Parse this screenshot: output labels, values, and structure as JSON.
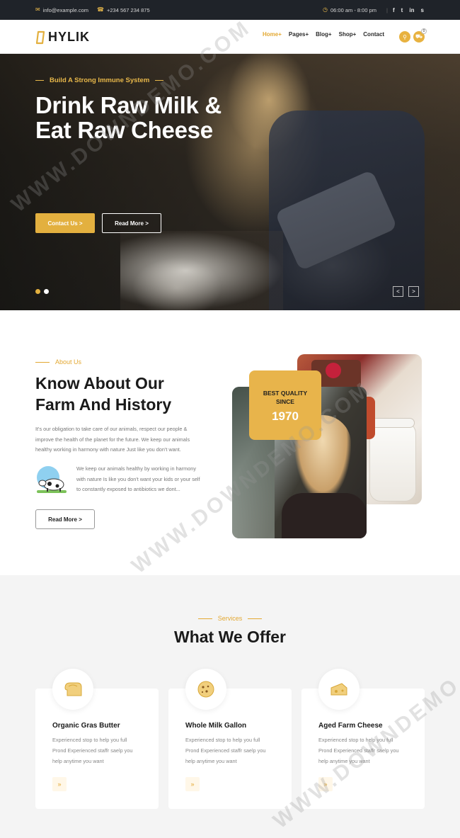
{
  "topbar": {
    "email": "info@example.com",
    "phone": "+234 567 234 875",
    "hours": "06:00 am - 8:00 pm",
    "social_icons": [
      "facebook-icon",
      "twitter-icon",
      "linkedin-icon",
      "skype-icon"
    ],
    "social_glyphs": [
      "f",
      "t",
      "in",
      "s"
    ]
  },
  "header": {
    "logo_text": "HYLIK",
    "nav": [
      "Home+",
      "Pages+",
      "Blog+",
      "Shop+",
      "Contact"
    ],
    "cart_count": "0"
  },
  "hero": {
    "subtitle": "Build A Strong Immune System",
    "title_line1": "Drink Raw Milk &",
    "title_line2": "Eat Raw Cheese",
    "primary_button": "Contact Us >",
    "secondary_button": "Read More >",
    "prev": "<",
    "next": ">"
  },
  "about": {
    "tag": "About Us",
    "title_line1": "Know About Our",
    "title_line2": "Farm And History",
    "para1_line1": "It's our obligation to take care of our animals, respect our people &",
    "para1_line2": "improve the health of the planet for the future. We keep our animals",
    "para1_line3": "healthy working in harmony with nature Just like you don't want.",
    "para2_line1": "We keep our animals healthy by working in harmony",
    "para2_line2": "with nature Is like you don't want your kids or your self",
    "para2_line3": "to constantly exposed to antibiotics we dont...",
    "button": "Read More >",
    "badge_line1": "BEST QUALITY",
    "badge_line2": "SINCE",
    "badge_year": "1970"
  },
  "services": {
    "tag": "Services",
    "title": "What We Offer",
    "cards": [
      {
        "title": "Organic Gras Butter",
        "line1": "Experienced stop to help you full",
        "line2": "Prond Experienced staffr saelp you",
        "line3": "help anytime you want",
        "go": "»"
      },
      {
        "title": "Whole Milk Gallon",
        "line1": "Experienced stop to help you full",
        "line2": "Prond Experienced staffr saelp you",
        "line3": "help anytime you want",
        "go": "»"
      },
      {
        "title": "Aged Farm Cheese",
        "line1": "Experienced stop to help you full",
        "line2": "Prond Experienced staffr saelp you",
        "line3": "help anytime you want",
        "go": "»"
      }
    ]
  },
  "watermark": "WWW.DOWNDEMO.COM",
  "colors": {
    "accent": "#e3b03f",
    "dark": "#1f2329",
    "services_bg": "#f4f4f4"
  }
}
